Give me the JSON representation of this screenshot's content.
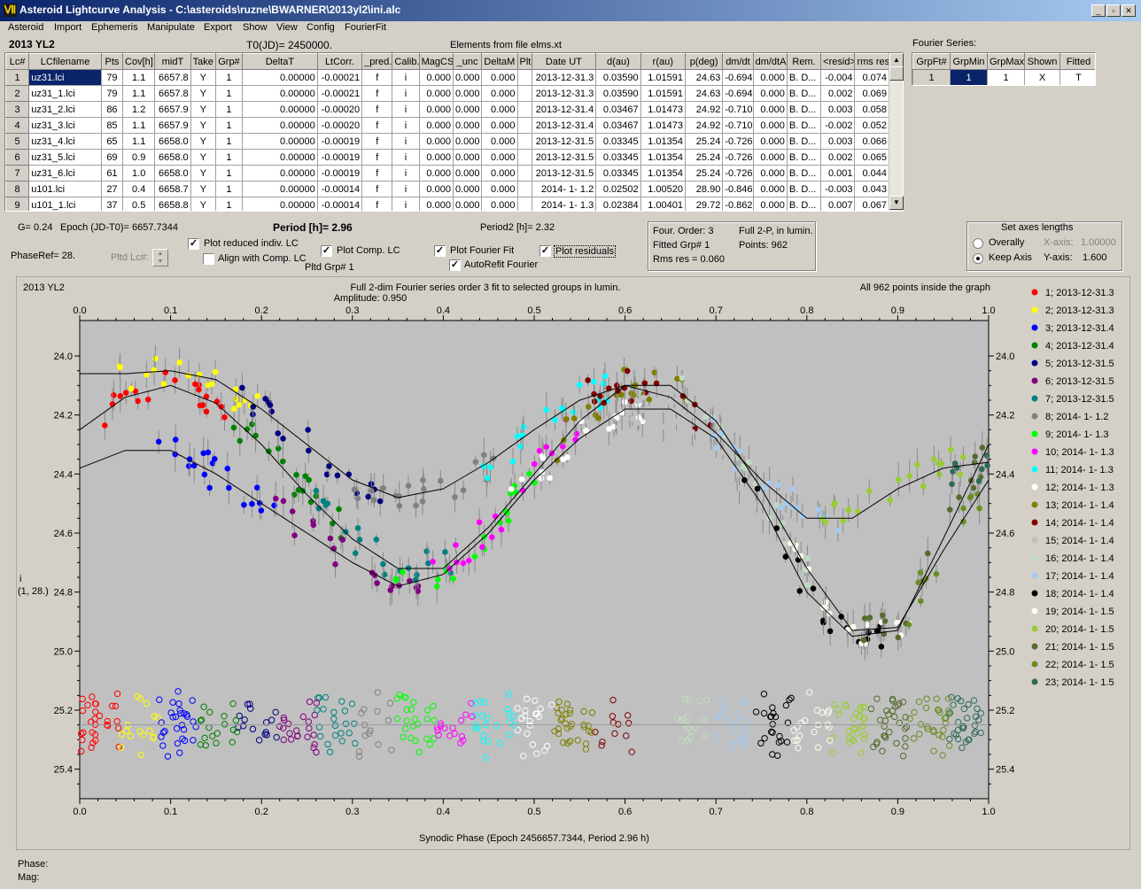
{
  "window": {
    "title": "Asteroid Lightcurve Analysis - C:\\asteroids\\ruzne\\BWARNER\\2013yl2\\ini.alc",
    "app_icon": "lightcurve-app-icon"
  },
  "menu": [
    "Asteroid",
    "Import",
    "Ephemeris",
    "Manipulate",
    "Export",
    "Show",
    "View",
    "Config",
    "FourierFit"
  ],
  "header": {
    "object": "2013 YL2",
    "t0": "T0(JD)= 2450000.",
    "elements": "Elements from file elms.xt",
    "fourier_series_label": "Fourier Series:"
  },
  "lc_table": {
    "columns": [
      "Lc#",
      "LCfilename",
      "Pts",
      "Cov[h]",
      "midT",
      "Take",
      "Grp#",
      "DeltaT",
      "LtCorr.",
      "_pred.",
      "Calib.",
      "MagCS",
      "_unc",
      "DeltaM",
      "Plt",
      "Date UT",
      "d(au)",
      "r(au)",
      "p(deg)",
      "dm/dt",
      "dm/dtA",
      "Rem.",
      "<resid>",
      "rms res"
    ],
    "rows": [
      [
        "1",
        "uz31.lci",
        "79",
        "1.1",
        "6657.8",
        "Y",
        "1",
        "0.00000",
        "-0.00021",
        "f",
        "i",
        "0.000",
        "0.000",
        "0.000",
        "",
        "2013-12-31.3",
        "0.03590",
        "1.01591",
        "24.63",
        "-0.694",
        "0.000",
        "B. D...",
        "-0.004",
        "0.074"
      ],
      [
        "2",
        "uz31_1.lci",
        "79",
        "1.1",
        "6657.8",
        "Y",
        "1",
        "0.00000",
        "-0.00021",
        "f",
        "i",
        "0.000",
        "0.000",
        "0.000",
        "",
        "2013-12-31.3",
        "0.03590",
        "1.01591",
        "24.63",
        "-0.694",
        "0.000",
        "B. D...",
        "0.002",
        "0.069"
      ],
      [
        "3",
        "uz31_2.lci",
        "86",
        "1.2",
        "6657.9",
        "Y",
        "1",
        "0.00000",
        "-0.00020",
        "f",
        "i",
        "0.000",
        "0.000",
        "0.000",
        "",
        "2013-12-31.4",
        "0.03467",
        "1.01473",
        "24.92",
        "-0.710",
        "0.000",
        "B. D...",
        "0.003",
        "0.058"
      ],
      [
        "4",
        "uz31_3.lci",
        "85",
        "1.1",
        "6657.9",
        "Y",
        "1",
        "0.00000",
        "-0.00020",
        "f",
        "i",
        "0.000",
        "0.000",
        "0.000",
        "",
        "2013-12-31.4",
        "0.03467",
        "1.01473",
        "24.92",
        "-0.710",
        "0.000",
        "B. D...",
        "-0.002",
        "0.052"
      ],
      [
        "5",
        "uz31_4.lci",
        "65",
        "1.1",
        "6658.0",
        "Y",
        "1",
        "0.00000",
        "-0.00019",
        "f",
        "i",
        "0.000",
        "0.000",
        "0.000",
        "",
        "2013-12-31.5",
        "0.03345",
        "1.01354",
        "25.24",
        "-0.726",
        "0.000",
        "B. D...",
        "0.003",
        "0.066"
      ],
      [
        "6",
        "uz31_5.lci",
        "69",
        "0.9",
        "6658.0",
        "Y",
        "1",
        "0.00000",
        "-0.00019",
        "f",
        "i",
        "0.000",
        "0.000",
        "0.000",
        "",
        "2013-12-31.5",
        "0.03345",
        "1.01354",
        "25.24",
        "-0.726",
        "0.000",
        "B. D...",
        "0.002",
        "0.065"
      ],
      [
        "7",
        "uz31_6.lci",
        "61",
        "1.0",
        "6658.0",
        "Y",
        "1",
        "0.00000",
        "-0.00019",
        "f",
        "i",
        "0.000",
        "0.000",
        "0.000",
        "",
        "2013-12-31.5",
        "0.03345",
        "1.01354",
        "25.24",
        "-0.726",
        "0.000",
        "B. D...",
        "0.001",
        "0.044"
      ],
      [
        "8",
        "u101.lci",
        "27",
        "0.4",
        "6658.7",
        "Y",
        "1",
        "0.00000",
        "-0.00014",
        "f",
        "i",
        "0.000",
        "0.000",
        "0.000",
        "",
        "2014- 1- 1.2",
        "0.02502",
        "1.00520",
        "28.90",
        "-0.846",
        "0.000",
        "B. D...",
        "-0.003",
        "0.043"
      ],
      [
        "9",
        "u101_1.lci",
        "37",
        "0.5",
        "6658.8",
        "Y",
        "1",
        "0.00000",
        "-0.00014",
        "f",
        "i",
        "0.000",
        "0.000",
        "0.000",
        "",
        "2014- 1- 1.3",
        "0.02384",
        "1.00401",
        "29.72",
        "-0.862",
        "0.000",
        "B. D...",
        "0.007",
        "0.067"
      ]
    ]
  },
  "fourier_table": {
    "columns": [
      "GrpFt#",
      "GrpMin",
      "GrpMax",
      "Shown",
      "Fitted"
    ],
    "row": [
      "1",
      "1",
      "1",
      "X",
      "T"
    ]
  },
  "controls": {
    "g": "G= 0.24",
    "epoch": "Epoch (JD-T0)= 6657.7344",
    "period": "Period [h]= 2.96",
    "period2": "Period2 [h]= 2.32",
    "phaseref": "PhaseRef= 28.",
    "pltd_lc": "Pltd Lc#:",
    "plot_reduced": "Plot reduced indiv. LC",
    "align": "Align with Comp. LC",
    "plot_comp": "Plot Comp. LC",
    "pltd_grp": "Pltd Grp#  1",
    "plot_fourier": "Plot Fourier Fit",
    "autorefit": "AutoRefit Fourier",
    "plot_resid": "Plot residuals",
    "four_order": "Four. Order:  3",
    "fitted_grp": "Fitted Grp# 1",
    "rms": "Rms res      = 0.060",
    "full2p": "Full 2-P, in lumin.",
    "points": "Points: 962",
    "axes_title": "Set axes lengths",
    "overally": "Overally",
    "keep_axis": "Keep Axis",
    "xaxis_label": "X-axis:",
    "xaxis_val": "1.00000",
    "yaxis_label": "Y-axis:",
    "yaxis_val": "1.600"
  },
  "plot": {
    "name": "2013 YL2",
    "title1": "Full 2-dim Fourier series order 3 fit to selected groups in lumin.",
    "title2": "Amplitude: 0.950",
    "points_note": "All 962 points inside the graph",
    "ylabel1": "i",
    "ylabel2": "(1, 28.)",
    "xlabel": "Synodic Phase (Epoch 2456657.7344, Period 2.96 h)",
    "x_ticks": [
      "0.0",
      "0.1",
      "0.2",
      "0.3",
      "0.4",
      "0.5",
      "0.6",
      "0.7",
      "0.8",
      "0.9",
      "1.0"
    ],
    "y_ticks": [
      "24.0",
      "24.2",
      "24.4",
      "24.6",
      "24.8",
      "25.0",
      "25.2",
      "25.4"
    ],
    "legend": [
      {
        "label": "1; 2013-12-31.3",
        "color": "#ff0000"
      },
      {
        "label": "2; 2013-12-31.3",
        "color": "#ffff00"
      },
      {
        "label": "3; 2013-12-31.4",
        "color": "#0000ff"
      },
      {
        "label": "4; 2013-12-31.4",
        "color": "#008000"
      },
      {
        "label": "5; 2013-12-31.5",
        "color": "#000080"
      },
      {
        "label": "6; 2013-12-31.5",
        "color": "#800080"
      },
      {
        "label": "7; 2013-12-31.5",
        "color": "#008080"
      },
      {
        "label": "8; 2014- 1- 1.2",
        "color": "#808080"
      },
      {
        "label": "9; 2014- 1- 1.3",
        "color": "#00ff00"
      },
      {
        "label": "10; 2014- 1- 1.3",
        "color": "#ff00ff"
      },
      {
        "label": "11; 2014- 1- 1.3",
        "color": "#00ffff"
      },
      {
        "label": "12; 2014- 1- 1.3",
        "color": "#ffffff"
      },
      {
        "label": "13; 2014- 1- 1.4",
        "color": "#808000"
      },
      {
        "label": "14; 2014- 1- 1.4",
        "color": "#800000"
      },
      {
        "label": "15; 2014- 1- 1.4",
        "color": "#c0c0c0"
      },
      {
        "label": "16; 2014- 1- 1.4",
        "color": "#c0dcc0"
      },
      {
        "label": "17; 2014- 1- 1.4",
        "color": "#a6caf0"
      },
      {
        "label": "18; 2014- 1- 1.4",
        "color": "#000000"
      },
      {
        "label": "19; 2014- 1- 1.5",
        "color": "#fffbf0"
      },
      {
        "label": "20; 2014- 1- 1.5",
        "color": "#9acd32"
      },
      {
        "label": "21; 2014- 1- 1.5",
        "color": "#556b2f"
      },
      {
        "label": "22; 2014- 1- 1.5",
        "color": "#6b8e23"
      },
      {
        "label": "23; 2014- 1- 1.5",
        "color": "#2e6b57"
      }
    ]
  },
  "status": {
    "phase": "Phase:",
    "mag": "Mag:"
  },
  "chart_data": {
    "type": "scatter",
    "xlim": [
      0.0,
      1.0
    ],
    "ylim": [
      23.88,
      25.5
    ],
    "y_inverted": true,
    "xlabel": "Synodic Phase (Epoch 2456657.7344, Period 2.96 h)",
    "grid": false,
    "fourier_curves": [
      {
        "x": [
          0.0,
          0.05,
          0.1,
          0.15,
          0.2,
          0.25,
          0.3,
          0.35,
          0.4,
          0.45,
          0.5,
          0.55,
          0.6,
          0.65,
          0.7,
          0.75,
          0.8,
          0.85,
          0.9,
          0.95,
          1.0
        ],
        "y": [
          24.25,
          24.14,
          24.1,
          24.16,
          24.3,
          24.47,
          24.62,
          24.72,
          24.72,
          24.58,
          24.4,
          24.22,
          24.1,
          24.1,
          24.22,
          24.45,
          24.72,
          24.93,
          24.92,
          24.66,
          24.42
        ]
      },
      {
        "x": [
          0.0,
          0.05,
          0.1,
          0.15,
          0.2,
          0.25,
          0.3,
          0.35,
          0.4,
          0.45,
          0.5,
          0.55,
          0.6,
          0.65,
          0.7,
          0.75,
          0.8,
          0.85,
          0.9,
          0.95,
          1.0
        ],
        "y": [
          24.06,
          24.06,
          24.05,
          24.08,
          24.18,
          24.3,
          24.42,
          24.48,
          24.45,
          24.36,
          24.25,
          24.15,
          24.1,
          24.14,
          24.26,
          24.42,
          24.55,
          24.55,
          24.45,
          24.38,
          24.36
        ]
      },
      {
        "x": [
          0.0,
          0.05,
          0.1,
          0.15,
          0.2,
          0.25,
          0.3,
          0.35,
          0.4,
          0.45,
          0.5,
          0.55,
          0.6,
          0.65,
          0.7,
          0.75,
          0.8,
          0.85,
          0.9,
          0.95,
          1.0
        ],
        "y": [
          24.38,
          24.32,
          24.32,
          24.4,
          24.5,
          24.6,
          24.7,
          24.78,
          24.74,
          24.6,
          24.42,
          24.28,
          24.18,
          24.18,
          24.28,
          24.5,
          24.8,
          24.95,
          24.93,
          24.62,
          24.3
        ]
      }
    ],
    "residual_band": {
      "y_center": 25.25,
      "half_width": 0.12
    },
    "series": [
      {
        "name": "1; 2013-12-31.3",
        "x_range": [
          0.0,
          0.2
        ],
        "y_center": 24.08
      },
      {
        "name": "3; 2013-12-31.4",
        "x_range": [
          0.0,
          0.2
        ],
        "y_center": 24.48
      },
      {
        "name": "5; 2013-12-31.5",
        "x_range": [
          0.68,
          1.0
        ],
        "y_center": 24.6
      },
      {
        "name": "9; 2014- 1- 1.3",
        "x_range": [
          0.35,
          0.6
        ],
        "y_center": 24.5
      },
      {
        "name": "12; 2014- 1- 1.3",
        "x_range": [
          0.85,
          1.0
        ],
        "y_center": 24.8
      }
    ]
  }
}
